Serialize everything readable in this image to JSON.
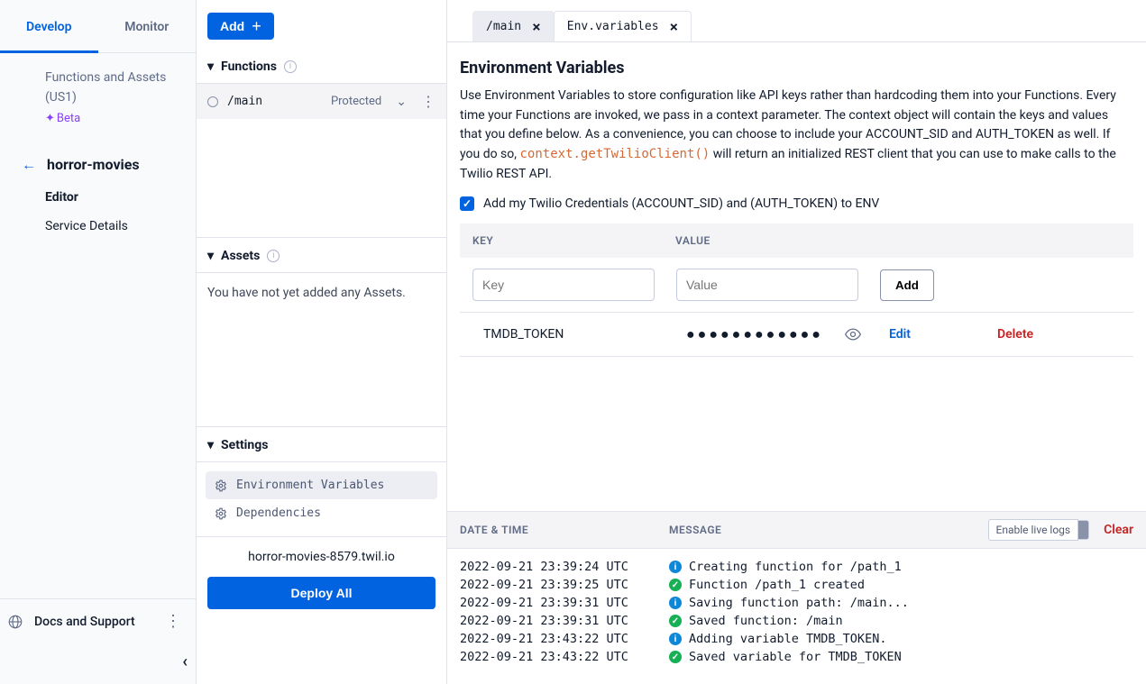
{
  "sidebar": {
    "tabs": {
      "develop": "Develop",
      "monitor": "Monitor"
    },
    "meta_line1": "Functions and Assets",
    "meta_line2": "(US1)",
    "beta_label": "Beta",
    "service_name": "horror-movies",
    "nav_editor": "Editor",
    "nav_service_details": "Service Details",
    "docs_label": "Docs and Support"
  },
  "midcol": {
    "add_label": "Add",
    "section_functions": "Functions",
    "fn_name": "/main",
    "fn_visibility": "Protected",
    "section_assets": "Assets",
    "assets_empty": "You have not yet added any Assets.",
    "section_settings": "Settings",
    "settings_env": "Environment Variables",
    "settings_deps": "Dependencies",
    "deploy_url": "horror-movies-8579.twil.io",
    "deploy_btn": "Deploy All"
  },
  "tabs": {
    "main_tab": "/main",
    "env_tab": "Env.variables"
  },
  "env": {
    "title": "Environment Variables",
    "desc1": "Use Environment Variables to store configuration like API keys rather than hardcoding them into your Functions. Every time your Functions are invoked, we pass in a context parameter. The context object will contain the keys and values that you define below. As a convenience, you can choose to include your ACCOUNT_SID and AUTH_TOKEN as well. If you do so, ",
    "code_call": "context.getTwilioClient()",
    "desc2": " will return an initialized REST client that you can use to make calls to the Twilio REST API.",
    "checkbox_label": "Add my Twilio Credentials (ACCOUNT_SID) and (AUTH_TOKEN) to ENV",
    "header_key": "KEY",
    "header_value": "VALUE",
    "key_placeholder": "Key",
    "value_placeholder": "Value",
    "add_btn": "Add",
    "row_key": "TMDB_TOKEN",
    "row_value_masked": "●●●●●●●●●●●●",
    "edit": "Edit",
    "delete": "Delete"
  },
  "logs": {
    "header_date": "DATE & TIME",
    "header_msg": "MESSAGE",
    "live_logs": "Enable live logs",
    "clear": "Clear",
    "lines": [
      {
        "ts": "2022-09-21 23:39:24 UTC",
        "type": "info",
        "msg": "Creating function for /path_1"
      },
      {
        "ts": "2022-09-21 23:39:25 UTC",
        "type": "ok",
        "msg": "Function /path_1 created"
      },
      {
        "ts": "2022-09-21 23:39:31 UTC",
        "type": "info",
        "msg": "Saving function path: /main..."
      },
      {
        "ts": "2022-09-21 23:39:31 UTC",
        "type": "ok",
        "msg": "Saved function: /main"
      },
      {
        "ts": "2022-09-21 23:43:22 UTC",
        "type": "info",
        "msg": "Adding variable TMDB_TOKEN."
      },
      {
        "ts": "2022-09-21 23:43:22 UTC",
        "type": "ok",
        "msg": "Saved variable for TMDB_TOKEN"
      }
    ]
  }
}
